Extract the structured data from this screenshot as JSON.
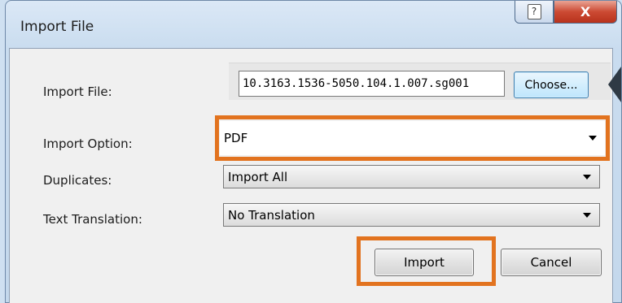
{
  "window": {
    "title": "Import File"
  },
  "titlebar": {
    "help_glyph": "?",
    "close_glyph": "X"
  },
  "form": {
    "import_file_label": "Import File:",
    "import_file_value": "10.3163.1536-5050.104.1.007.sg001",
    "choose_label": "Choose...",
    "import_option_label": "Import Option:",
    "import_option_value": "PDF",
    "duplicates_label": "Duplicates:",
    "duplicates_value": "Import All",
    "text_translation_label": "Text Translation:",
    "text_translation_value": "No Translation"
  },
  "actions": {
    "import_label": "Import",
    "cancel_label": "Cancel"
  },
  "colors": {
    "highlight": "#e2731f",
    "close_button": "#c8452f",
    "choose_button": "#bee6fd"
  }
}
